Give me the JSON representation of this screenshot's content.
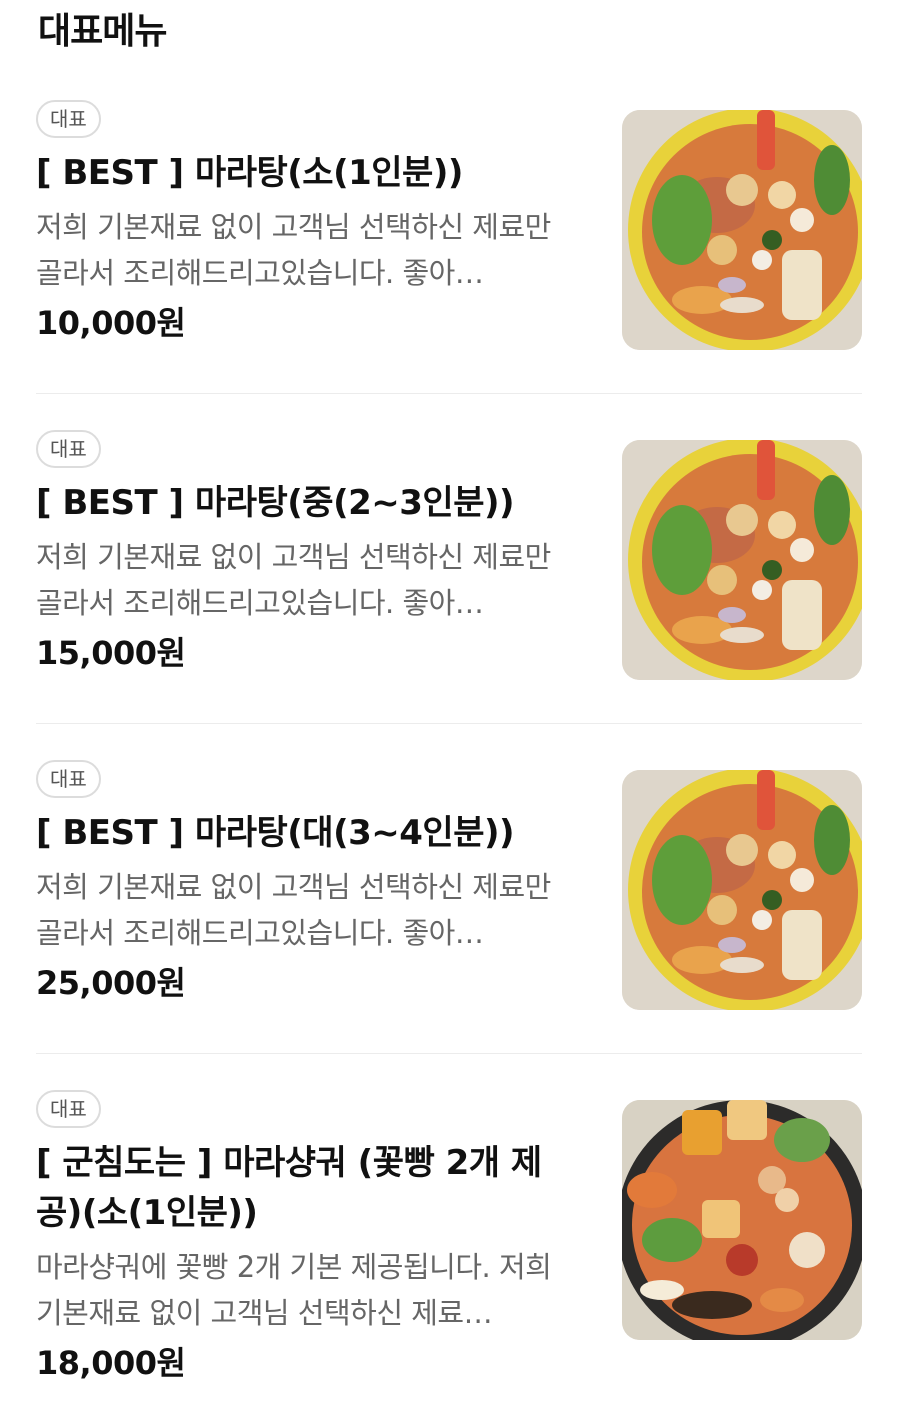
{
  "section": {
    "title": "대표메뉴"
  },
  "items": [
    {
      "badge": "대표",
      "name": "[ BEST ] 마라탕(소(1인분))",
      "description": "저희 기본재료 없이 고객님 선택하신 제료만 골라서 조리해드리고있습니다. 좋아…",
      "price": "10,000원",
      "image": "mala-tang-photo"
    },
    {
      "badge": "대표",
      "name": "[ BEST ] 마라탕(중(2~3인분))",
      "description": "저희 기본재료 없이 고객님 선택하신 제료만 골라서 조리해드리고있습니다. 좋아…",
      "price": "15,000원",
      "image": "mala-tang-photo"
    },
    {
      "badge": "대표",
      "name": "[ BEST ] 마라탕(대(3~4인분))",
      "description": "저희 기본재료 없이 고객님 선택하신 제료만 골라서 조리해드리고있습니다. 좋아…",
      "price": "25,000원",
      "image": "mala-tang-photo"
    },
    {
      "badge": "대표",
      "name": "[ 군침도는 ] 마라샹궈 (꽃빵 2개 제공)(소(1인분))",
      "description": "마라샹궈에 꽃빵 2개 기본 제공됩니다. 저희 기본재료 없이 고객님 선택하신 제료…",
      "price": "18,000원",
      "image": "mala-xiangguo-photo"
    }
  ]
}
